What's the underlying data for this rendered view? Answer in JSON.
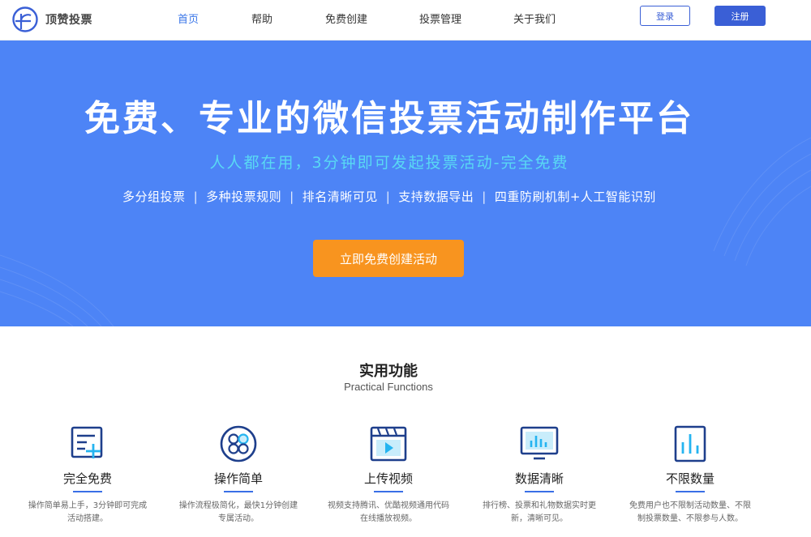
{
  "brand": {
    "name": "顶赞投票"
  },
  "nav": {
    "items": [
      {
        "label": "首页",
        "active": true
      },
      {
        "label": "帮助"
      },
      {
        "label": "免费创建"
      },
      {
        "label": "投票管理"
      },
      {
        "label": "关于我们"
      }
    ],
    "login": "登录",
    "register": "注册"
  },
  "hero": {
    "title": "免费、专业的微信投票活动制作平台",
    "subtitle": "人人都在用，3分钟即可发起投票活动-完全免费",
    "features": [
      "多分组投票",
      "多种投票规则",
      "排名清晰可见",
      "支持数据导出",
      "四重防刷机制+人工智能识别"
    ],
    "cta": "立即免费创建活动"
  },
  "features": {
    "title": "实用功能",
    "subtitle": "Practical Functions",
    "items": [
      {
        "icon": "document-plus-icon",
        "name": "完全免费",
        "desc": "操作简单易上手，3分钟即可完成活动搭建。"
      },
      {
        "icon": "circles-grid-icon",
        "name": "操作简单",
        "desc": "操作流程极简化，最快1分钟创建专属活动。"
      },
      {
        "icon": "video-play-icon",
        "name": "上传视频",
        "desc": "视频支持腾讯、优酷视频通用代码在线播放视频。"
      },
      {
        "icon": "monitor-chart-icon",
        "name": "数据清晰",
        "desc": "排行榜、投票和礼物数据实时更新，清晰可见。"
      },
      {
        "icon": "bar-chart-icon",
        "name": "不限数量",
        "desc": "免费用户也不限制活动数量、不限制投票数量、不限参与人数。"
      }
    ]
  },
  "colors": {
    "primary": "#3a5fd6",
    "hero": "#4d84f6",
    "accent": "#f8941f",
    "subtitle": "#59d9f4"
  }
}
